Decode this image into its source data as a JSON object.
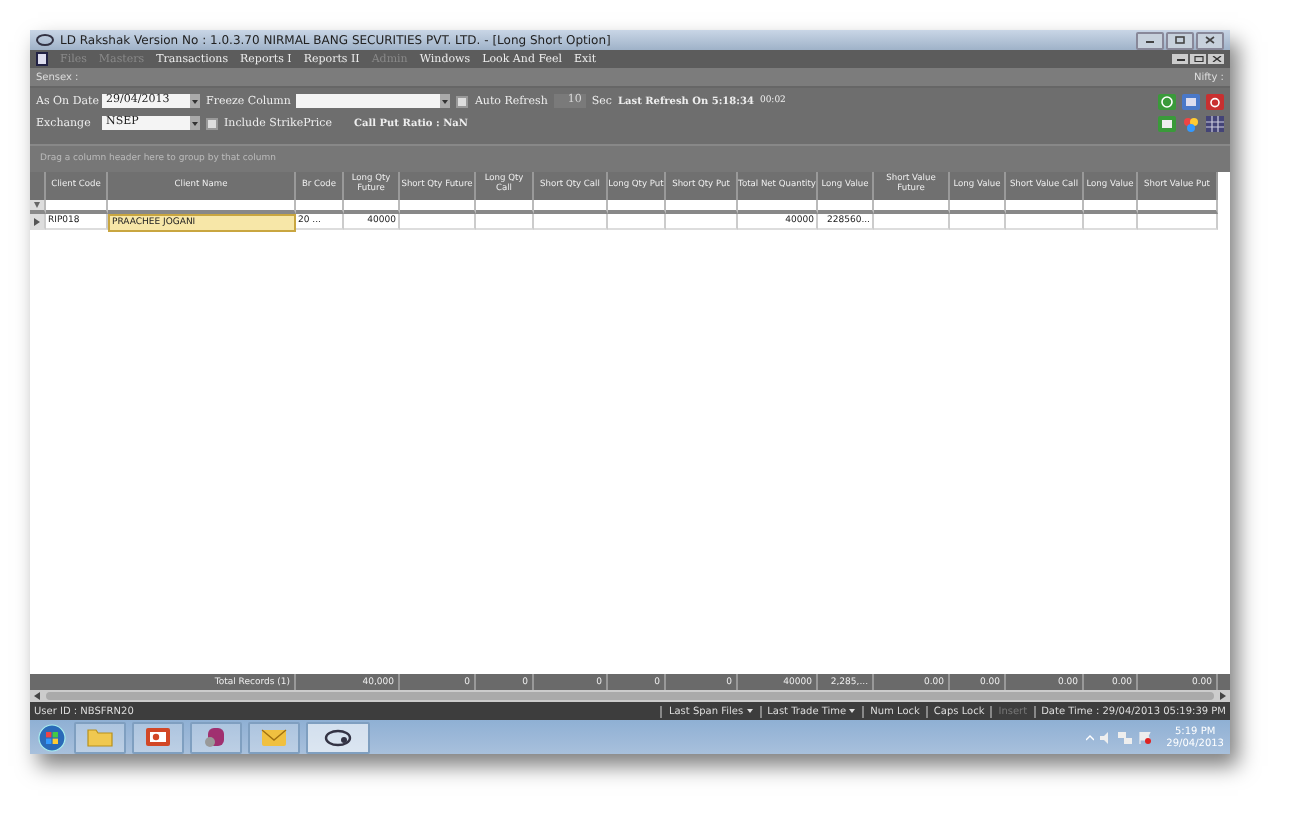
{
  "window": {
    "title": "LD Rakshak Version No : 1.0.3.70 NIRMAL BANG SECURITIES PVT. LTD. - [Long Short Option]"
  },
  "menu": [
    {
      "label": "Files",
      "disabled": true
    },
    {
      "label": "Masters",
      "disabled": true
    },
    {
      "label": "Transactions",
      "disabled": false
    },
    {
      "label": "Reports I",
      "disabled": false
    },
    {
      "label": "Reports II",
      "disabled": false
    },
    {
      "label": "Admin",
      "disabled": true
    },
    {
      "label": "Windows",
      "disabled": false
    },
    {
      "label": "Look And Feel",
      "disabled": false
    },
    {
      "label": "Exit",
      "disabled": false
    }
  ],
  "index_bar": {
    "left": "Sensex :",
    "right": "Nifty :"
  },
  "toolbar": {
    "date_label": "As On Date",
    "date": "29/04/2013",
    "freeze_label": "Freeze Column",
    "auto_refresh": {
      "label": "Auto Refresh",
      "checked": false
    },
    "interval": "10",
    "interval_disabled": true,
    "sec_label": "Sec",
    "last_refresh": "Last Refresh On 5:18:34",
    "elapsed": "00:02",
    "exchange_label": "Exchange",
    "exchange": "NSEP",
    "include_strike": {
      "label": "Include StrikePrice",
      "checked": false
    },
    "ratio": "Call Put Ratio : NaN"
  },
  "group_hint": "Drag a column header here to group by that column",
  "table": {
    "columns": [
      "Client Code",
      "Client Name",
      "Br Code",
      "Long Qty Future",
      "Short Qty Future",
      "Long Qty Call",
      "Short Qty Call",
      "Long Qty Put",
      "Short Qty Put",
      "Total Net Quantity",
      "Long Value",
      "Short Value Future",
      "Long Value",
      "Short Value Call",
      "Long Value",
      "Short Value Put"
    ],
    "rows": [
      {
        "cells": [
          "RIP018",
          "PRAACHEE JOGANI",
          "20   ...",
          "40000",
          "",
          "",
          "",
          "",
          "",
          "40000",
          "228560...",
          "",
          "",
          "",
          "",
          ""
        ],
        "selected": true
      }
    ],
    "footer": {
      "label": "Total Records (1)",
      "totals": [
        "40,000",
        "0",
        "0",
        "0",
        "0",
        "0",
        "40000",
        "2,285,...",
        "0.00",
        "0.00",
        "0.00",
        "0.00",
        "0.00"
      ]
    }
  },
  "status_bar": {
    "user": "User ID : NBSFRN20",
    "items": [
      {
        "label": "Last Span Files",
        "dropdown": true,
        "disabled": false
      },
      {
        "label": "Last Trade Time",
        "dropdown": true,
        "disabled": false
      },
      {
        "label": "Num Lock",
        "dropdown": false,
        "disabled": false
      },
      {
        "label": "Caps Lock",
        "dropdown": false,
        "disabled": false
      },
      {
        "label": "Insert",
        "dropdown": false,
        "disabled": true
      },
      {
        "label": "Date Time : 29/04/2013 05:19:39 PM",
        "dropdown": false,
        "disabled": false
      }
    ]
  },
  "taskbar": {
    "time": "5:19 PM",
    "date": "29/04/2013"
  }
}
